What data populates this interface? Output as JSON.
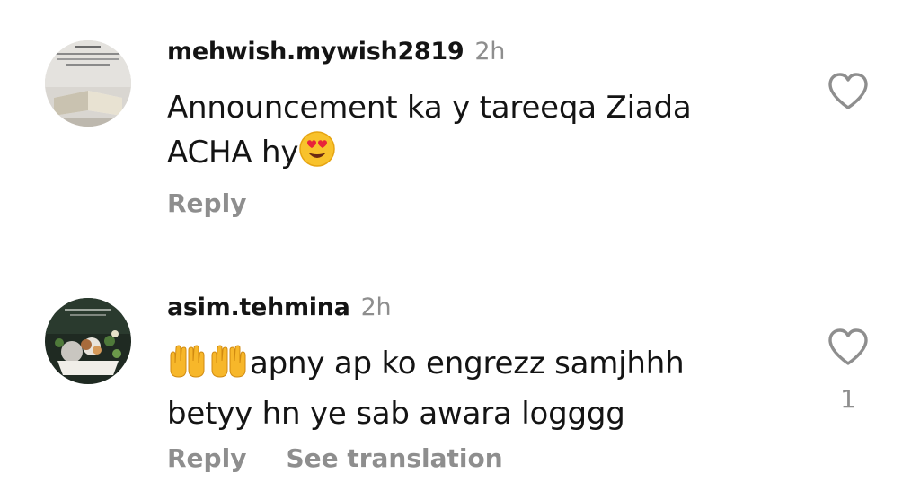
{
  "comments": [
    {
      "username": "mehwish.mywish2819",
      "time": "2h",
      "line1": "Announcement ka y tareeqa Ziada",
      "line2": "ACHA hy",
      "reply_label": "Reply",
      "like_icon": "heart-outline-icon",
      "emoji": "smiling-face-with-heart-eyes"
    },
    {
      "username": "asim.tehmina",
      "time": "2h",
      "line1": "apny ap ko engrezz samjhhh",
      "line2": "betyy hn ye sab awara logggg",
      "reply_label": "Reply",
      "translate_label": "See translation",
      "like_count": "1",
      "like_icon": "heart-outline-icon",
      "emoji": "raising-hands"
    }
  ],
  "colors": {
    "text": "#141414",
    "secondary": "#8e8e8e",
    "background": "#ffffff"
  }
}
